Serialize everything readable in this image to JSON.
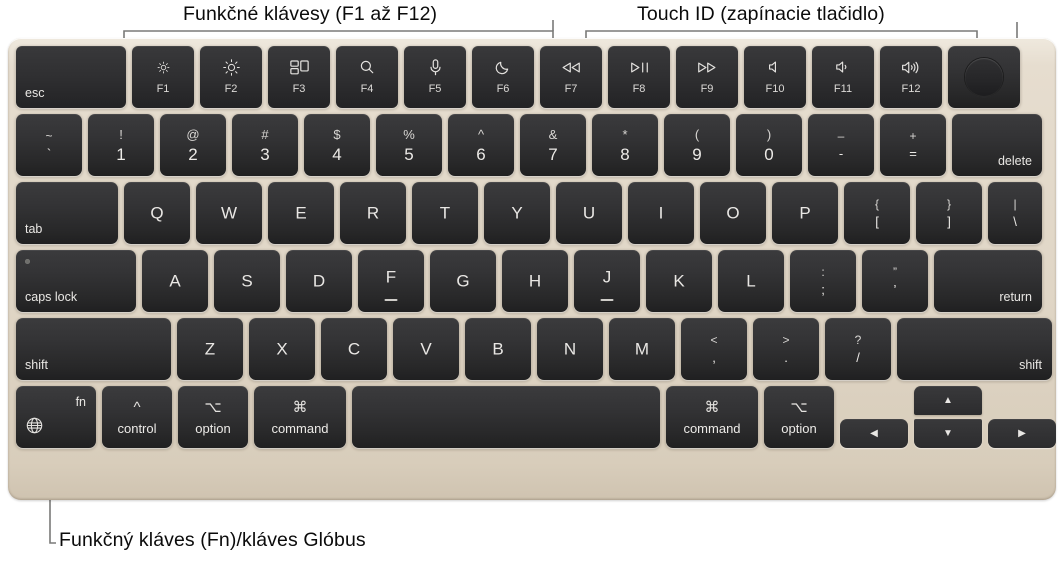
{
  "callouts": {
    "function_keys": "Funkčné klávesy (F1 až F12)",
    "touch_id": "Touch ID (zapínacie tlačidlo)",
    "globe_key": "Funkčný kláves (Fn)/kláves Glóbus"
  },
  "colors": {
    "chassis": "#e0d6c6",
    "key": "#2f2f31",
    "key_text": "#e9e7e4",
    "callout_text": "#0b0b0b",
    "leader_line": "#7a7a78",
    "page_background": "#ffffff"
  },
  "keyboard": {
    "function_row": [
      {
        "label": "esc",
        "icon": "",
        "fnum": "",
        "name": "escape"
      },
      {
        "label": "",
        "icon": "brightness-down-icon",
        "fnum": "F1",
        "name": "f1-brightness-down"
      },
      {
        "label": "",
        "icon": "brightness-up-icon",
        "fnum": "F2",
        "name": "f2-brightness-up"
      },
      {
        "label": "",
        "icon": "mission-control-icon",
        "fnum": "F3",
        "name": "f3-mission-control"
      },
      {
        "label": "",
        "icon": "search-icon",
        "fnum": "F4",
        "name": "f4-spotlight"
      },
      {
        "label": "",
        "icon": "microphone-icon",
        "fnum": "F5",
        "name": "f5-dictation"
      },
      {
        "label": "",
        "icon": "moon-icon",
        "fnum": "F6",
        "name": "f6-do-not-disturb"
      },
      {
        "label": "",
        "icon": "rewind-icon",
        "fnum": "F7",
        "name": "f7-rewind"
      },
      {
        "label": "",
        "icon": "play-pause-icon",
        "fnum": "F8",
        "name": "f8-play-pause"
      },
      {
        "label": "",
        "icon": "fast-forward-icon",
        "fnum": "F9",
        "name": "f9-fast-forward"
      },
      {
        "label": "",
        "icon": "volume-mute-icon",
        "fnum": "F10",
        "name": "f10-mute"
      },
      {
        "label": "",
        "icon": "volume-down-icon",
        "fnum": "F11",
        "name": "f11-volume-down"
      },
      {
        "label": "",
        "icon": "volume-up-icon",
        "fnum": "F12",
        "name": "f12-volume-up"
      },
      {
        "label": "",
        "icon": "touch-id-icon",
        "fnum": "",
        "name": "touch-id"
      }
    ],
    "number_row": [
      {
        "top": "~",
        "bottom": "`",
        "name": "backtick"
      },
      {
        "top": "!",
        "bottom": "1",
        "name": "one"
      },
      {
        "top": "@",
        "bottom": "2",
        "name": "two"
      },
      {
        "top": "#",
        "bottom": "3",
        "name": "three"
      },
      {
        "top": "$",
        "bottom": "4",
        "name": "four"
      },
      {
        "top": "%",
        "bottom": "5",
        "name": "five"
      },
      {
        "top": "^",
        "bottom": "6",
        "name": "six"
      },
      {
        "top": "&",
        "bottom": "7",
        "name": "seven"
      },
      {
        "top": "*",
        "bottom": "8",
        "name": "eight"
      },
      {
        "top": "(",
        "bottom": "9",
        "name": "nine"
      },
      {
        "top": ")",
        "bottom": "0",
        "name": "zero"
      },
      {
        "top": "–",
        "bottom": "-",
        "name": "minus"
      },
      {
        "top": "+",
        "bottom": "=",
        "name": "equals"
      },
      {
        "top": "",
        "bottom": "",
        "corner": "delete",
        "name": "delete"
      }
    ],
    "qwerty_row": [
      {
        "corner": "tab",
        "name": "tab"
      },
      {
        "center": "Q",
        "name": "q"
      },
      {
        "center": "W",
        "name": "w"
      },
      {
        "center": "E",
        "name": "e"
      },
      {
        "center": "R",
        "name": "r"
      },
      {
        "center": "T",
        "name": "t"
      },
      {
        "center": "Y",
        "name": "y"
      },
      {
        "center": "U",
        "name": "u"
      },
      {
        "center": "I",
        "name": "i"
      },
      {
        "center": "O",
        "name": "o"
      },
      {
        "center": "P",
        "name": "p"
      },
      {
        "top": "{",
        "bottom": "[",
        "name": "left-bracket"
      },
      {
        "top": "}",
        "bottom": "]",
        "name": "right-bracket"
      },
      {
        "top": "|",
        "bottom": "\\",
        "name": "backslash"
      }
    ],
    "home_row": [
      {
        "corner": "caps lock",
        "name": "caps-lock"
      },
      {
        "center": "A",
        "name": "a"
      },
      {
        "center": "S",
        "name": "s"
      },
      {
        "center": "D",
        "name": "d"
      },
      {
        "center": "F",
        "name": "f",
        "bump": true
      },
      {
        "center": "G",
        "name": "g"
      },
      {
        "center": "H",
        "name": "h"
      },
      {
        "center": "J",
        "name": "j",
        "bump": true
      },
      {
        "center": "K",
        "name": "k"
      },
      {
        "center": "L",
        "name": "l"
      },
      {
        "top": ":",
        "bottom": ";",
        "name": "semicolon"
      },
      {
        "top": "”",
        "bottom": "’",
        "name": "quote"
      },
      {
        "corner": "return",
        "name": "return"
      }
    ],
    "shift_row": [
      {
        "corner": "shift",
        "name": "left-shift"
      },
      {
        "center": "Z",
        "name": "z"
      },
      {
        "center": "X",
        "name": "x"
      },
      {
        "center": "C",
        "name": "c"
      },
      {
        "center": "V",
        "name": "v"
      },
      {
        "center": "B",
        "name": "b"
      },
      {
        "center": "N",
        "name": "n"
      },
      {
        "center": "M",
        "name": "m"
      },
      {
        "top": "<",
        "bottom": ",",
        "name": "comma"
      },
      {
        "top": ">",
        "bottom": ".",
        "name": "period"
      },
      {
        "top": "?",
        "bottom": "/",
        "name": "slash"
      },
      {
        "corner": "shift",
        "name": "right-shift"
      }
    ],
    "bottom_row": {
      "fn": {
        "label": "fn",
        "icon": "globe-icon",
        "name": "fn-globe"
      },
      "left_control": {
        "symbol": "^",
        "label": "control",
        "name": "control"
      },
      "left_option": {
        "symbol": "⌥",
        "label": "option",
        "name": "left-option"
      },
      "left_command": {
        "symbol": "⌘",
        "label": "command",
        "name": "left-command"
      },
      "space": {
        "label": "",
        "name": "space"
      },
      "right_command": {
        "symbol": "⌘",
        "label": "command",
        "name": "right-command"
      },
      "right_option": {
        "symbol": "⌥",
        "label": "option",
        "name": "right-option"
      },
      "arrows": {
        "left": "◀",
        "up": "▲",
        "down": "▼",
        "right": "▶"
      }
    }
  }
}
